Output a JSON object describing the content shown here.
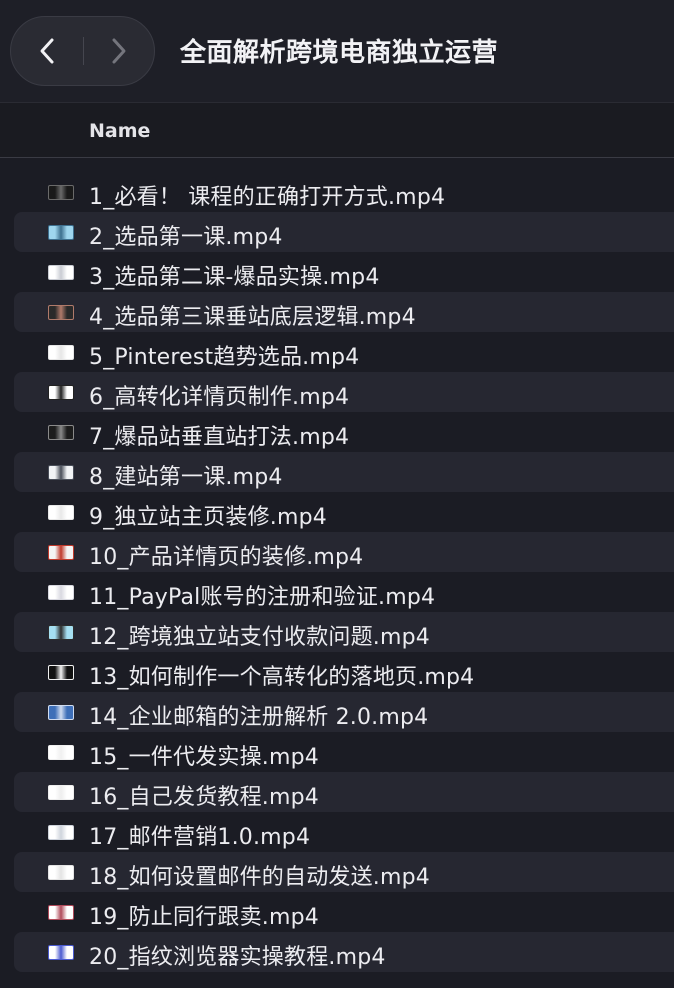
{
  "window": {
    "title": "全面解析跨境电商独立运营",
    "back_icon": "chevron-left-icon",
    "forward_icon": "chevron-right-icon"
  },
  "list_header": {
    "name_label": "Name"
  },
  "files": [
    {
      "name": "1_必看！ 课程的正确打开方式.mp4",
      "thumb": [
        "#1a1a1a",
        "#6a6a6a"
      ]
    },
    {
      "name": "2_选品第一课.mp4",
      "thumb": [
        "#9fd6ee",
        "#3d6f8e"
      ]
    },
    {
      "name": "3_选品第二课-爆品实操.mp4",
      "thumb": [
        "#ffffff",
        "#c9ccd3"
      ]
    },
    {
      "name": "4_选品第三课垂站底层逻辑.mp4",
      "thumb": [
        "#2a2a2a",
        "#b07a6a"
      ]
    },
    {
      "name": "5_Pinterest趋势选品.mp4",
      "thumb": [
        "#ffffff",
        "#e6e6e6"
      ]
    },
    {
      "name": "6_高转化详情页制作.mp4",
      "thumb": [
        "#ffffff",
        "#222222"
      ]
    },
    {
      "name": "7_爆品站垂直站打法.mp4",
      "thumb": [
        "#1c1c1c",
        "#8a8a8a"
      ]
    },
    {
      "name": "8_建站第一课.mp4",
      "thumb": [
        "#f2f4f6",
        "#4a4f5a"
      ]
    },
    {
      "name": "9_独立站主页装修.mp4",
      "thumb": [
        "#ffffff",
        "#e8e8e8"
      ]
    },
    {
      "name": "10_产品详情页的装修.mp4",
      "thumb": [
        "#f4f4f4",
        "#c0392b"
      ]
    },
    {
      "name": "11_PayPal账号的注册和验证.mp4",
      "thumb": [
        "#ffffff",
        "#d8d8e0"
      ]
    },
    {
      "name": "12_跨境独立站支付收款问题.mp4",
      "thumb": [
        "#a6e0f2",
        "#2d2d2d"
      ]
    },
    {
      "name": "13_如何制作一个高转化的落地页.mp4",
      "thumb": [
        "#111111",
        "#f0f0f0"
      ]
    },
    {
      "name": "14_企业邮箱的注册解析 2.0.mp4",
      "thumb": [
        "#3e6fb8",
        "#d0dcf0"
      ]
    },
    {
      "name": "15_一件代发实操.mp4",
      "thumb": [
        "#ffffff",
        "#f0f0f0"
      ]
    },
    {
      "name": "16_自己发货教程.mp4",
      "thumb": [
        "#ffffff",
        "#eeeeee"
      ]
    },
    {
      "name": "17_邮件营销1.0.mp4",
      "thumb": [
        "#ffffff",
        "#cfd4dc"
      ]
    },
    {
      "name": "18_如何设置邮件的自动发送.mp4",
      "thumb": [
        "#ffffff",
        "#e4e4e4"
      ]
    },
    {
      "name": "19_防止同行跟卖.mp4",
      "thumb": [
        "#ffffff",
        "#b04a5a"
      ]
    },
    {
      "name": "20_指纹浏览器实操教程.mp4",
      "thumb": [
        "#ffffff",
        "#4a5ad0"
      ]
    }
  ]
}
